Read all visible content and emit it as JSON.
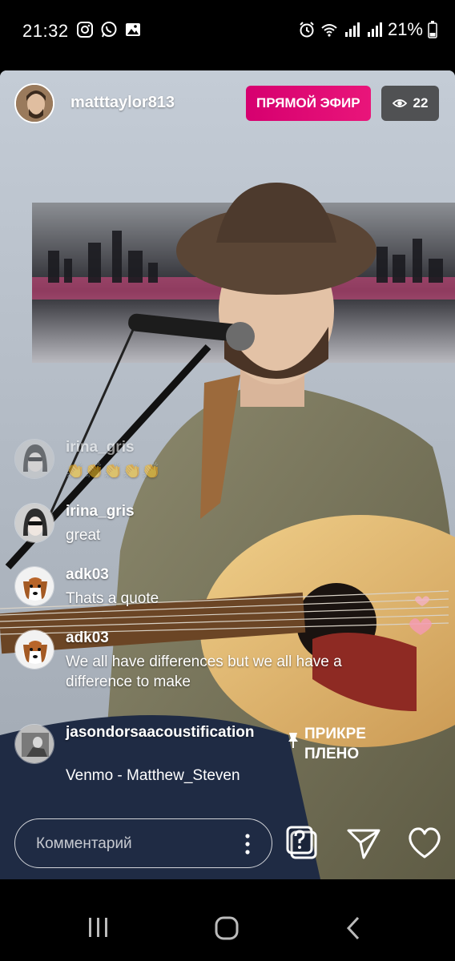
{
  "status_bar": {
    "time": "21:32",
    "battery": "21%"
  },
  "live": {
    "host_username": "matttaylor813",
    "live_badge": "ПРЯМОЙ ЭФИР",
    "viewer_count": "22"
  },
  "comments": [
    {
      "username": "irina_gris",
      "text": "👏👏👏👏👏",
      "avatar": "avatar-irina"
    },
    {
      "username": "irina_gris",
      "text": "great",
      "avatar": "avatar-irina"
    },
    {
      "username": "adk03",
      "text": "Thats a quote",
      "avatar": "avatar-dog"
    },
    {
      "username": "adk03",
      "text": "We all have differences but we all have a difference to make",
      "avatar": "avatar-dog"
    }
  ],
  "pinned": {
    "username": "jasondorsaacoustification",
    "label_line1": "ПРИКРЕ",
    "label_line2": "ПЛЕНО",
    "text": "Venmo - Matthew_Steven"
  },
  "input": {
    "placeholder": "Комментарий"
  },
  "icons": {
    "question": "question-stickers-icon",
    "send": "paper-plane-icon",
    "like": "heart-icon",
    "eye": "eye-icon",
    "pin": "pin-icon"
  }
}
